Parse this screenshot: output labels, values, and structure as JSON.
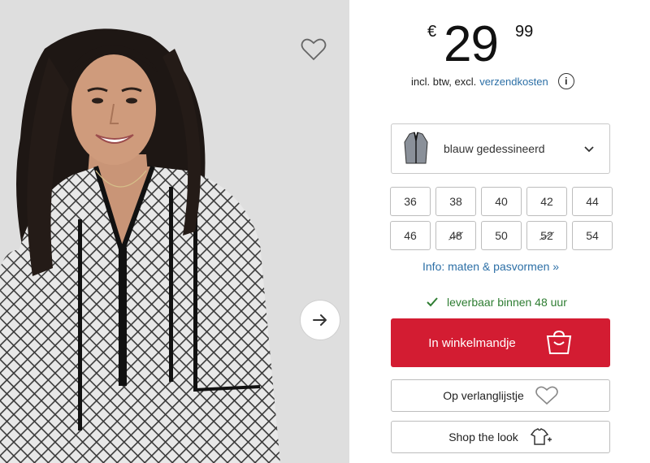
{
  "product": {
    "price": {
      "currency": "€",
      "euros": "29",
      "cents": "99"
    },
    "vat_text": "incl. btw, excl.",
    "shipping_link": "verzendkosten",
    "info_icon": "i",
    "color": {
      "selected": "blauw gedessineerd",
      "icon": "blouse-swatch"
    },
    "sizes": [
      {
        "label": "36",
        "available": true
      },
      {
        "label": "38",
        "available": true
      },
      {
        "label": "40",
        "available": true
      },
      {
        "label": "42",
        "available": true
      },
      {
        "label": "44",
        "available": true
      },
      {
        "label": "46",
        "available": true
      },
      {
        "label": "48",
        "available": false
      },
      {
        "label": "50",
        "available": true
      },
      {
        "label": "52",
        "available": false
      },
      {
        "label": "54",
        "available": true
      }
    ],
    "size_info_link": "Info: maten & pasvormen »",
    "delivery": "leverbaar binnen 48 uur"
  },
  "actions": {
    "add_to_cart": "In winkelmandje",
    "wishlist": "Op verlanglijstje",
    "shop_the_look": "Shop the look"
  },
  "icons": {
    "heart": "heart-icon",
    "next": "arrow-right-icon",
    "bag": "shopping-bag-icon",
    "shirt": "shirt-plus-icon",
    "check": "check-icon",
    "chevron": "chevron-down-icon"
  },
  "colors": {
    "accent_red": "#d31c32",
    "link_blue": "#2c6fa6",
    "success_green": "#2e7d32"
  }
}
